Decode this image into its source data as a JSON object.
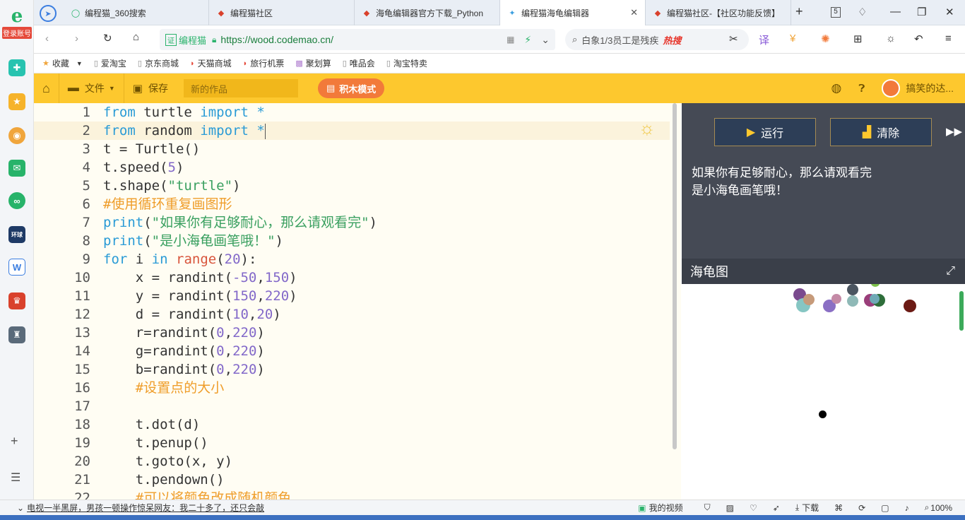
{
  "sidebar": {
    "login_label": "登录账号",
    "logo_letter": "e"
  },
  "tabs": [
    {
      "title": "编程猫_360搜索",
      "active": false
    },
    {
      "title": "编程猫社区",
      "active": false
    },
    {
      "title": "海龟编辑器官方下载_Python",
      "active": false
    },
    {
      "title": "编程猫海龟编辑器",
      "active": true
    },
    {
      "title": "编程猫社区-【社区功能反馈】",
      "active": false
    }
  ],
  "tab_count": "5",
  "address": {
    "site_badge": "证",
    "site_name": "编程猫",
    "url_scheme": "https://",
    "url_host": "wood.codemao.cn/"
  },
  "search": {
    "text": "白象1/3员工是残疾",
    "hot_label": "热搜"
  },
  "bookmarks": [
    "收藏",
    "爱淘宝",
    "京东商城",
    "天猫商城",
    "旅行机票",
    "聚划算",
    "唯品会",
    "淘宝特卖"
  ],
  "appbar": {
    "file_label": "文件",
    "save_label": "保存",
    "work_name_placeholder": "新的作品",
    "mode_label": "积木模式",
    "user_name": "搞笑的达..."
  },
  "editor": {
    "lines": [
      "from turtle import *",
      "from random import *",
      "t = Turtle()",
      "t.speed(5)",
      "t.shape(\"turtle\")",
      "#使用循环重复画图形",
      "print(\"如果你有足够耐心，那么请观看完\")",
      "print(\"是小海龟画笔哦！\")",
      "for i in range(20):",
      "    x = randint(-50,150)",
      "    y = randint(150,220)",
      "    d = randint(10,20)",
      "    r=randint(0,220)",
      "    g=randint(0,220)",
      "    b=randint(0,220)",
      "    #设置点的大小",
      "",
      "    t.dot(d)",
      "    t.penup()",
      "    t.goto(x, y)",
      "    t.pendown()",
      "    #可以将颜色改成随机颜色"
    ]
  },
  "panel": {
    "run_label": "运行",
    "clear_label": "清除",
    "output_lines": [
      "如果你有足够耐心，那么请观看完",
      "是小海龟画笔哦！"
    ],
    "canvas_title": "海龟图"
  },
  "canvas_dots": [
    {
      "color": "#7a4a8e"
    },
    {
      "color": "#86c6c3"
    },
    {
      "color": "#c69a7a"
    },
    {
      "color": "#8a6fc4"
    },
    {
      "color": "#c48aa6"
    },
    {
      "color": "#4b5560"
    },
    {
      "color": "#8fb9b7"
    },
    {
      "color": "#9a3e7a"
    },
    {
      "color": "#2e6e3a"
    },
    {
      "color": "#6fa9b6"
    },
    {
      "color": "#6b1a14"
    },
    {
      "color": "#7cc04a"
    },
    {
      "color": "#000000"
    }
  ],
  "statusbar": {
    "news": "电视一半黑屏，男孩一顿操作惊呆网友：我二十多了，还只会敲",
    "video_label": "我的视频",
    "download_label": "下载",
    "zoom": "100%"
  },
  "colors": {
    "accent_yellow": "#fdc82e",
    "mode_orange": "#f27a3a",
    "panel_dark": "#454a55"
  }
}
